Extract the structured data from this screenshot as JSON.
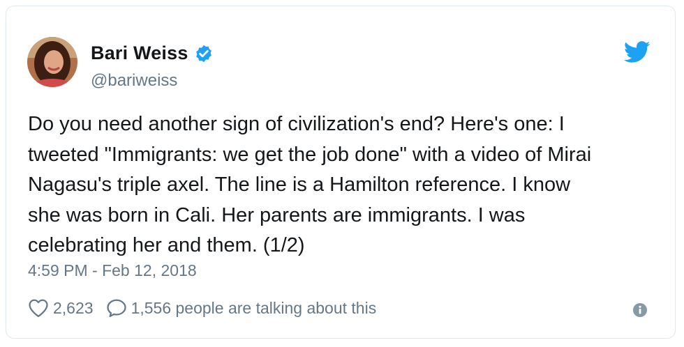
{
  "author": {
    "display_name": "Bari Weiss",
    "handle": "@bariweiss",
    "verified": true,
    "avatar_icon": "profile-photo"
  },
  "tweet": {
    "text": "Do you need another sign of civilization's end? Here's one: I\ntweeted \"Immigrants: we get the job done\" with a video of Mirai\nNagasu's triple axel. The line is a Hamilton reference. I know\nshe was born in Cali. Her parents are immigrants. I was\ncelebrating her and them. (1/2)",
    "timestamp": "4:59 PM - Feb 12, 2018"
  },
  "engagement": {
    "likes": "2,623",
    "talking": "1,556 people are talking about this"
  },
  "icons": {
    "brand": "twitter-bird-icon",
    "like": "heart-icon",
    "reply": "comment-bubble-icon",
    "info": "info-icon",
    "verified": "verified-badge-icon"
  },
  "colors": {
    "brand_blue": "#1da1f2",
    "text": "#14171a",
    "muted": "#657786",
    "border": "#e1e8ed"
  }
}
